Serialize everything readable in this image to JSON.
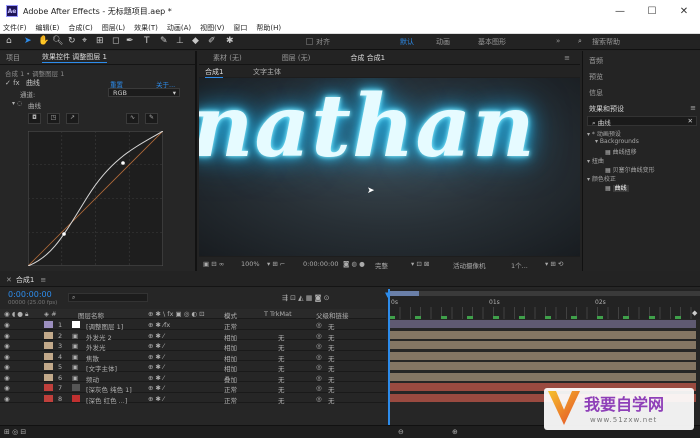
{
  "titlebar": {
    "app_icon": "Ae",
    "title": "Adobe After Effects - 无标题项目.aep *",
    "min": "—",
    "max": "☐",
    "close": "✕"
  },
  "menu": [
    "文件(F)",
    "编辑(E)",
    "合成(C)",
    "图层(L)",
    "效果(T)",
    "动画(A)",
    "视图(V)",
    "窗口",
    "帮助(H)"
  ],
  "toolbar": {
    "align_label": "对齐",
    "workspaces": [
      "默认",
      "动画",
      "基本图形"
    ],
    "search_placeholder": "搜索帮助"
  },
  "left_panel": {
    "tabs": [
      "项目",
      "效果控件 调整图层 1"
    ],
    "breadcrumb": "合成 1 • 调整图层 1",
    "effect": {
      "name": "曲线",
      "reset": "重置",
      "about": "关于..."
    },
    "channel_label": "通道:",
    "channel_value": "RGB",
    "curve_label": "曲线"
  },
  "comp_panel": {
    "tabs": [
      "素材 (无)",
      "图层 (无)",
      "合成 合成1"
    ],
    "subtabs": [
      "合成1",
      "文字主体"
    ],
    "viewer_text": "nathan",
    "footer": {
      "zoom": "100%",
      "time": "0:00:00:00",
      "quality": "完整",
      "camera": "活动摄像机",
      "views": "1个..."
    }
  },
  "right_panel": {
    "items": [
      "音频",
      "预览",
      "信息",
      "效果和预设"
    ],
    "search_value": "曲线",
    "tree": [
      {
        "label": "* 动画预设",
        "indent": 0
      },
      {
        "label": "Backgrounds",
        "indent": 1
      },
      {
        "label": "曲线扭移",
        "indent": 2
      },
      {
        "label": "扭曲",
        "indent": 0
      },
      {
        "label": "贝塞尔曲线变形",
        "indent": 2
      },
      {
        "label": "颜色校正",
        "indent": 0
      },
      {
        "label": "曲线",
        "indent": 2
      }
    ]
  },
  "timeline": {
    "tab": "合成1",
    "timecode": "0:00:00:00",
    "fps": "00000 (25.00 fps)",
    "col_layer": "图层名称",
    "col_mode": "模式",
    "col_trkmat": "T TrkMat",
    "col_parent": "父级和链接",
    "ruler": [
      "0s",
      "01s",
      "02s"
    ],
    "layers": [
      {
        "num": "1",
        "name": "[调整图层 1]",
        "mode": "正常",
        "trk": "",
        "parent": "无",
        "color": "#9c8fbf"
      },
      {
        "num": "2",
        "name": "外发光 2",
        "mode": "相加",
        "trk": "无",
        "parent": "无",
        "color": "#c2a98a"
      },
      {
        "num": "3",
        "name": "外发光",
        "mode": "相加",
        "trk": "无",
        "parent": "无",
        "color": "#c2a98a"
      },
      {
        "num": "4",
        "name": "焦散",
        "mode": "相加",
        "trk": "无",
        "parent": "无",
        "color": "#c2a98a"
      },
      {
        "num": "5",
        "name": "[文字主体]",
        "mode": "相加",
        "trk": "无",
        "parent": "无",
        "color": "#c2a98a"
      },
      {
        "num": "6",
        "name": "频动",
        "mode": "叠加",
        "trk": "无",
        "parent": "无",
        "color": "#c2a98a"
      },
      {
        "num": "7",
        "name": "[深灰色 纯色 1]",
        "mode": "正常",
        "trk": "无",
        "parent": "无",
        "color": "#c0403c"
      },
      {
        "num": "8",
        "name": "[深色 红色 ...]",
        "mode": "正常",
        "trk": "无",
        "parent": "无",
        "color": "#c0403c"
      }
    ]
  },
  "watermark": {
    "text": "我要自学网",
    "url": "www.51zxw.net"
  },
  "colors": {
    "accent": "#2d8ceb",
    "neon": "#bfeeff"
  }
}
